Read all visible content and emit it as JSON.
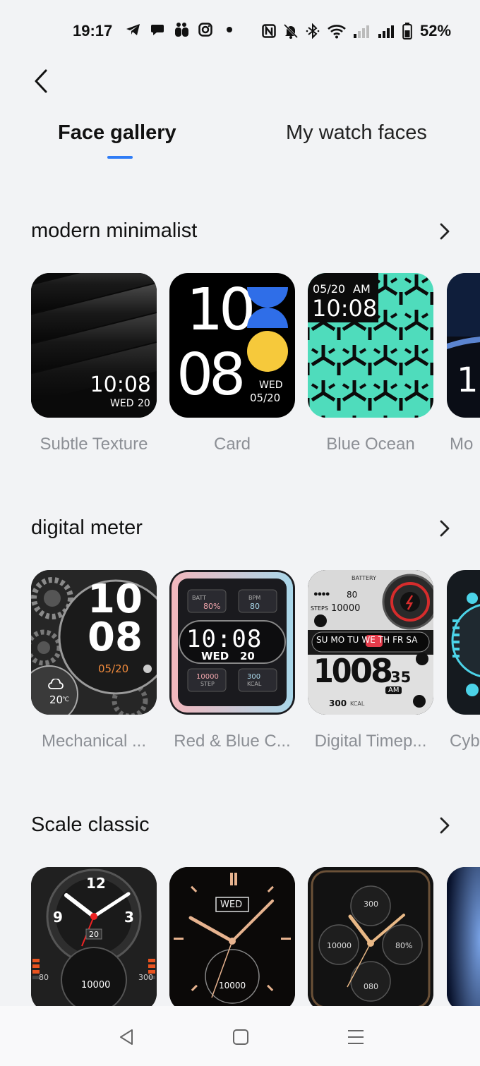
{
  "status_bar": {
    "time": "19:17",
    "left_icons": [
      "telegram-icon",
      "chat-bubble-icon",
      "family-icon",
      "instagram-icon",
      "dot-icon"
    ],
    "right_icons": [
      "nfc-icon",
      "mute-bell-icon",
      "bluetooth-icon",
      "wifi-icon",
      "signal-weak-icon",
      "signal-strong-icon",
      "battery-icon"
    ],
    "battery": "52%"
  },
  "tabs": {
    "active": "Face gallery",
    "inactive": "My watch faces",
    "accent": "#2f7cf6"
  },
  "sections": [
    {
      "title": "modern minimalist",
      "items": [
        {
          "label": "Subtle Texture",
          "face": {
            "time": "10:08",
            "day": "WED",
            "date": "20"
          }
        },
        {
          "label": "Card",
          "face": {
            "hour": "10",
            "minute": "08",
            "day": "WED",
            "date": "05/20"
          }
        },
        {
          "label": "Blue Ocean",
          "face": {
            "date": "05/20",
            "ampm": "AM",
            "time": "10:08"
          }
        },
        {
          "label": "Mo",
          "face": {
            "digit": "1"
          }
        }
      ]
    },
    {
      "title": "digital meter",
      "items": [
        {
          "label": "Mechanical ...",
          "face": {
            "hour": "10",
            "minute": "08",
            "date": "05/20",
            "temp": "20",
            "temp_unit": "℃"
          }
        },
        {
          "label": "Red & Blue C...",
          "face": {
            "batt_label": "BATT",
            "batt": "80%",
            "bpm_label": "BPM",
            "bpm": "80",
            "time": "10:08",
            "day": "WED",
            "date": "20",
            "steps": "10000",
            "steps_label": "STEP",
            "kcal": "300",
            "kcal_label": "KCAL"
          }
        },
        {
          "label": "Digital Timep...",
          "face": {
            "battery_label": "BATTERY",
            "battery": "80",
            "steps_label": "STEPS",
            "steps": "10000",
            "days": [
              "SU",
              "MO",
              "TU",
              "WE",
              "TH",
              "FR",
              "SA"
            ],
            "active_day": "WE",
            "hour": "10",
            "minute": "08",
            "seconds": "35",
            "ampm": "AM",
            "kcal": "300",
            "kcal_label": "KCAL"
          }
        },
        {
          "label": "Cyb",
          "face": {}
        }
      ]
    },
    {
      "title": "Scale classic",
      "items": [
        {
          "label": "",
          "face": {
            "n12": "12",
            "n9": "9",
            "n3": "3",
            "date": "20",
            "steps": "10000",
            "left": "80",
            "right": "300"
          }
        },
        {
          "label": "",
          "face": {
            "day": "WED",
            "steps": "10000"
          }
        },
        {
          "label": "",
          "face": {
            "top": "300",
            "left": "10000",
            "right": "80%",
            "bottom": "080"
          }
        },
        {
          "label": "",
          "face": {}
        }
      ]
    }
  ],
  "nav_bar": {
    "icons": [
      "back-triangle-icon",
      "home-square-icon",
      "recents-menu-icon"
    ]
  }
}
